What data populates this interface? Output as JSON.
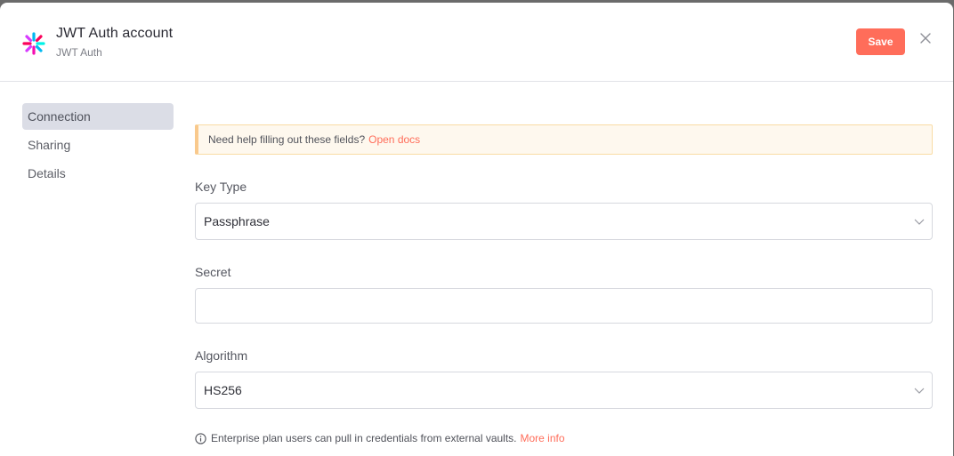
{
  "header": {
    "title": "JWT Auth account",
    "subtitle": "JWT Auth",
    "save_label": "Save",
    "logo_icon": "jwt-logo-icon",
    "close_icon": "close-icon"
  },
  "sidebar": {
    "items": [
      {
        "label": "Connection",
        "active": true
      },
      {
        "label": "Sharing",
        "active": false
      },
      {
        "label": "Details",
        "active": false
      }
    ]
  },
  "notice": {
    "text": "Need help filling out these fields?",
    "link": "Open docs"
  },
  "form": {
    "key_type": {
      "label": "Key Type",
      "value": "Passphrase"
    },
    "secret": {
      "label": "Secret",
      "value": ""
    },
    "algorithm": {
      "label": "Algorithm",
      "value": "HS256"
    }
  },
  "hint": {
    "text": "Enterprise plan users can pull in credentials from external vaults.",
    "link": "More info"
  },
  "colors": {
    "accent": "#ff6d5a",
    "active_nav_bg": "#dbdde6",
    "notice_bg": "#fef8ee"
  }
}
